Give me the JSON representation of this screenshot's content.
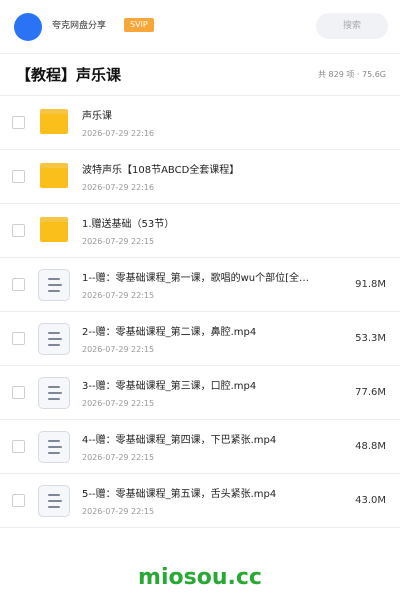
{
  "topbar": {
    "share_name": "夸克网盘分享",
    "badge": "SVIP",
    "search_placeholder": "搜索"
  },
  "header": {
    "title": "【教程】声乐课",
    "meta": "共 829 项 · 75.6G"
  },
  "items": [
    {
      "type": "folder",
      "name": "声乐课",
      "date": "2026-07-29 22:16",
      "size": ""
    },
    {
      "type": "folder",
      "name": "波特声乐【108节ABCD全套课程】",
      "date": "2026-07-29 22:16",
      "size": ""
    },
    {
      "type": "folder",
      "name": "1.赠送基础（53节）",
      "date": "2026-07-29 22:15",
      "size": ""
    },
    {
      "type": "file",
      "name": "1--赠：零基础课程_第一课，歌唱的wu个部位[全…",
      "date": "2026-07-29 22:15",
      "size": "91.8M"
    },
    {
      "type": "file",
      "name": "2--赠：零基础课程_第二课，鼻腔.mp4",
      "date": "2026-07-29 22:15",
      "size": "53.3M"
    },
    {
      "type": "file",
      "name": "3--赠：零基础课程_第三课，口腔.mp4",
      "date": "2026-07-29 22:15",
      "size": "77.6M"
    },
    {
      "type": "file",
      "name": "4--赠：零基础课程_第四课，下巴紧张.mp4",
      "date": "2026-07-29 22:15",
      "size": "48.8M"
    },
    {
      "type": "file",
      "name": "5--赠：零基础课程_第五课，舌头紧张.mp4",
      "date": "2026-07-29 22:15",
      "size": "43.0M"
    }
  ],
  "watermark": "miosou.cc",
  "colors": {
    "avatar": "#2a73f5",
    "badge": "#f7a63a",
    "folder": "#fbbf1c",
    "watermark": "#2aa836"
  }
}
